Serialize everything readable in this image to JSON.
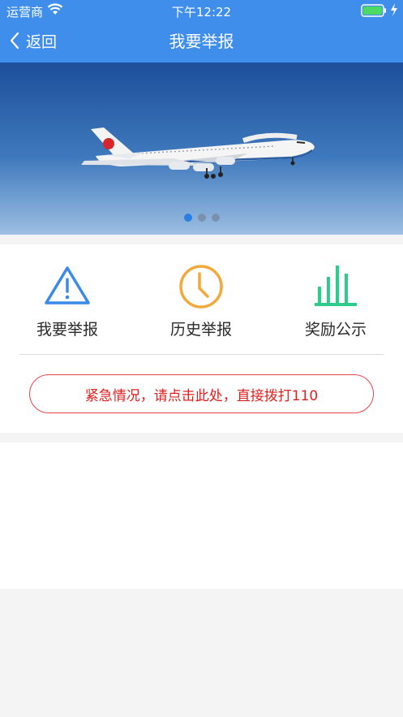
{
  "status_bar": {
    "carrier": "运营商",
    "time": "下午12:22"
  },
  "nav": {
    "back_label": "返回",
    "title": "我要举报"
  },
  "banner": {
    "slides": 3,
    "active_slide": 1
  },
  "menu": [
    {
      "label": "我要举报",
      "icon": "warning-icon",
      "color": "#3a8ae8"
    },
    {
      "label": "历史举报",
      "icon": "clock-icon",
      "color": "#f2a93b"
    },
    {
      "label": "奖励公示",
      "icon": "bar-chart-icon",
      "color": "#2ecc8a"
    }
  ],
  "emergency": {
    "label": "紧急情况，请点击此处，直接拨打110",
    "color": "#e11f1f"
  },
  "colors": {
    "header": "#3f8eeb",
    "sky_top": "#1d4f9a",
    "sky_bottom": "#8fb6dd"
  }
}
